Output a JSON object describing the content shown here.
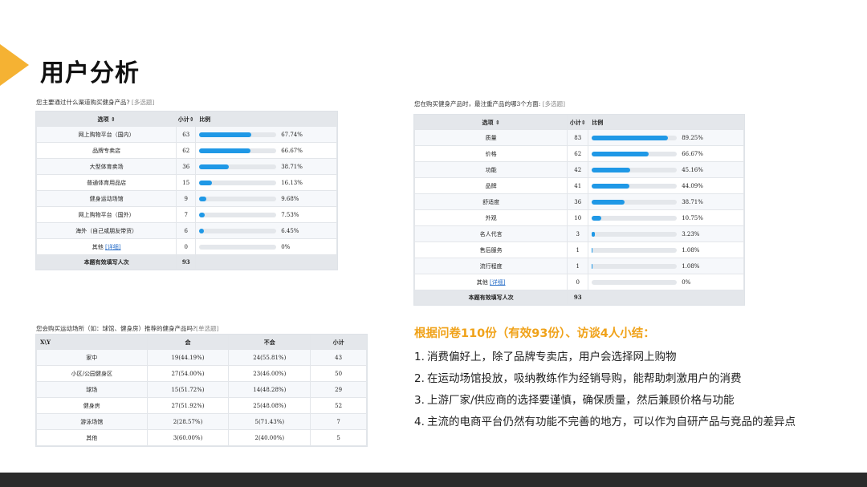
{
  "page": {
    "title": "用户分析",
    "accent_color": "#f5b233",
    "bottom_bar_color": "#2b2b2b"
  },
  "survey1": {
    "question": "您主要通过什么渠道购买健身产品?",
    "question_tag": "[多选题]",
    "headers": {
      "option": "选项 ⇕",
      "count": "小计⇕",
      "ratio": "比例"
    },
    "rows": [
      {
        "label": "网上购物平台（国内）",
        "count": "63",
        "percent": "67.74%",
        "value": 67.74
      },
      {
        "label": "品牌专卖店",
        "count": "62",
        "percent": "66.67%",
        "value": 66.67
      },
      {
        "label": "大型体育卖场",
        "count": "36",
        "percent": "38.71%",
        "value": 38.71
      },
      {
        "label": "普通体育用品店",
        "count": "15",
        "percent": "16.13%",
        "value": 16.13
      },
      {
        "label": "健身运动场馆",
        "count": "9",
        "percent": "9.68%",
        "value": 9.68
      },
      {
        "label": "网上购物平台（国外）",
        "count": "7",
        "percent": "7.53%",
        "value": 7.53
      },
      {
        "label": "海外（自己或朋友带货）",
        "count": "6",
        "percent": "6.45%",
        "value": 6.45
      }
    ],
    "other": {
      "label": "其他",
      "detail": "[详细]",
      "count": "0",
      "percent": "0%",
      "value": 0
    },
    "footer": {
      "label": "本题有效填写人次",
      "count": "93"
    }
  },
  "survey2": {
    "question": "您在购买健身产品时，最注重产品的哪3个方面:",
    "question_tag": "[多选题]",
    "headers": {
      "option": "选项 ⇕",
      "count": "小计⇕",
      "ratio": "比例"
    },
    "rows": [
      {
        "label": "质量",
        "count": "83",
        "percent": "89.25%",
        "value": 89.25
      },
      {
        "label": "价格",
        "count": "62",
        "percent": "66.67%",
        "value": 66.67
      },
      {
        "label": "功能",
        "count": "42",
        "percent": "45.16%",
        "value": 45.16
      },
      {
        "label": "品牌",
        "count": "41",
        "percent": "44.09%",
        "value": 44.09
      },
      {
        "label": "舒适度",
        "count": "36",
        "percent": "38.71%",
        "value": 38.71
      },
      {
        "label": "外观",
        "count": "10",
        "percent": "10.75%",
        "value": 10.75
      },
      {
        "label": "名人代言",
        "count": "3",
        "percent": "3.23%",
        "value": 3.23
      },
      {
        "label": "售后服务",
        "count": "1",
        "percent": "1.08%",
        "value": 1.08
      },
      {
        "label": "流行程度",
        "count": "1",
        "percent": "1.08%",
        "value": 1.08
      }
    ],
    "other": {
      "label": "其他",
      "detail": "[详细]",
      "count": "0",
      "percent": "0%",
      "value": 0
    },
    "footer": {
      "label": "本题有效填写人次",
      "count": "93"
    }
  },
  "survey3": {
    "question": "您会购买运动场所（如：球馆、健身房）推荐的健身产品吗?",
    "question_tag": "[单选题]",
    "headers": {
      "xy": "X\\Y",
      "yes": "会",
      "no": "不会",
      "total": "小计"
    },
    "rows": [
      {
        "label": "家中",
        "yes": "19(44.19%)",
        "no": "24(55.81%)",
        "total": "43"
      },
      {
        "label": "小区/公园健身区",
        "yes": "27(54.00%)",
        "no": "23(46.00%)",
        "total": "50"
      },
      {
        "label": "球场",
        "yes": "15(51.72%)",
        "no": "14(48.28%)",
        "total": "29"
      },
      {
        "label": "健身房",
        "yes": "27(51.92%)",
        "no": "25(48.08%)",
        "total": "52"
      },
      {
        "label": "游泳场馆",
        "yes": "2(28.57%)",
        "no": "5(71.43%)",
        "total": "7"
      },
      {
        "label": "其他",
        "yes": "3(60.00%)",
        "no": "2(40.00%)",
        "total": "5"
      }
    ]
  },
  "summary": {
    "title": "根据问卷110份（有效93份）、访谈4人小结：",
    "color": "#f0a219",
    "points": [
      {
        "num": "1.",
        "text": "消费偏好上，除了品牌专卖店，用户会选择网上购物"
      },
      {
        "num": "2.",
        "text": "在运动场馆投放，吸纳教练作为经销导购，能帮助刺激用户的消费"
      },
      {
        "num": "3.",
        "text": "上游厂家/供应商的选择要谨慎，确保质量，然后兼顾价格与功能"
      },
      {
        "num": "4.",
        "text": "主流的电商平台仍然有功能不完善的地方，可以作为自研产品与竞品的差异点"
      }
    ]
  }
}
